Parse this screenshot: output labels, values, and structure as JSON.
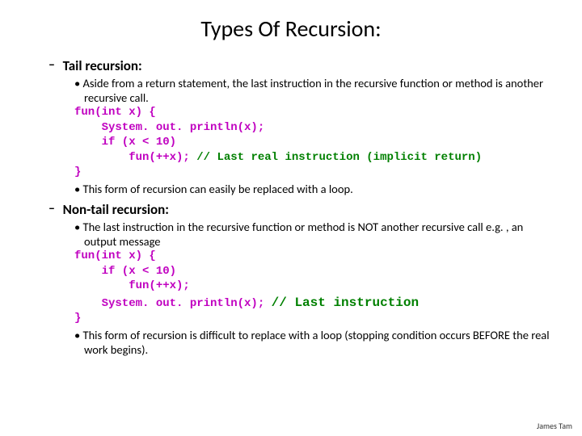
{
  "title": "Types Of Recursion:",
  "sec1": {
    "head": "Tail recursion:",
    "b1": "Aside from a return statement, the last instruction in the recursive function or method is another recursive call.",
    "c1": "fun(int x) {",
    "c2": "    System. out. println(x);",
    "c3": "    if (x < 10)",
    "c4a": "        fun(++x); ",
    "c4b": "// Last real instruction (implicit return)",
    "c5": "}",
    "b2": "This form of recursion can easily be replaced with a loop."
  },
  "sec2": {
    "head": "Non-tail recursion:",
    "b1": "The last instruction in the recursive function or method is NOT another recursive call e.g. , an output message",
    "c1": "fun(int x) {",
    "c2": "    if (x < 10)",
    "c3": "        fun(++x);",
    "c4a": "    System. out. println(x); ",
    "c4b": "// Last instruction",
    "c5": "}",
    "b2": "This form of recursion is difficult to replace with a loop (stopping condition occurs BEFORE the real work begins)."
  },
  "footer": "James Tam"
}
